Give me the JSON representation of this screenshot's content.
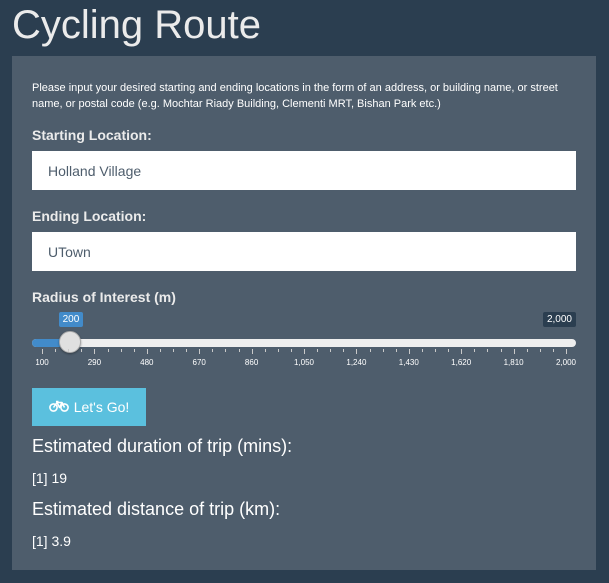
{
  "app": {
    "title": "Cycling Route"
  },
  "form": {
    "intro": "Please input your desired starting and ending locations in the form of an address, or building name, or street name, or postal code (e.g. Mochtar Riady Building, Clementi MRT, Bishan Park etc.)",
    "start_label": "Starting Location:",
    "start_value": "Holland Village",
    "end_label": "Ending Location:",
    "end_value": "UTown"
  },
  "slider": {
    "label": "Radius of Interest (m)",
    "min": 100,
    "max": 2000,
    "value": 200,
    "value_text": "200",
    "max_text": "2,000",
    "ticks": [
      "100",
      "290",
      "480",
      "670",
      "860",
      "1,050",
      "1,240",
      "1,430",
      "1,620",
      "1,810",
      "2,000"
    ]
  },
  "button": {
    "label": "Let's Go!",
    "icon": "bicycle-icon"
  },
  "output": {
    "duration_label": "Estimated duration of trip (mins):",
    "duration_value": "[1] 19",
    "distance_label": "Estimated distance of trip (km):",
    "distance_value": "[1] 3.9"
  },
  "colors": {
    "background": "#2b3e50",
    "panel": "#4e5d6c",
    "slider_fill": "#428bca",
    "button": "#5bc0de"
  }
}
